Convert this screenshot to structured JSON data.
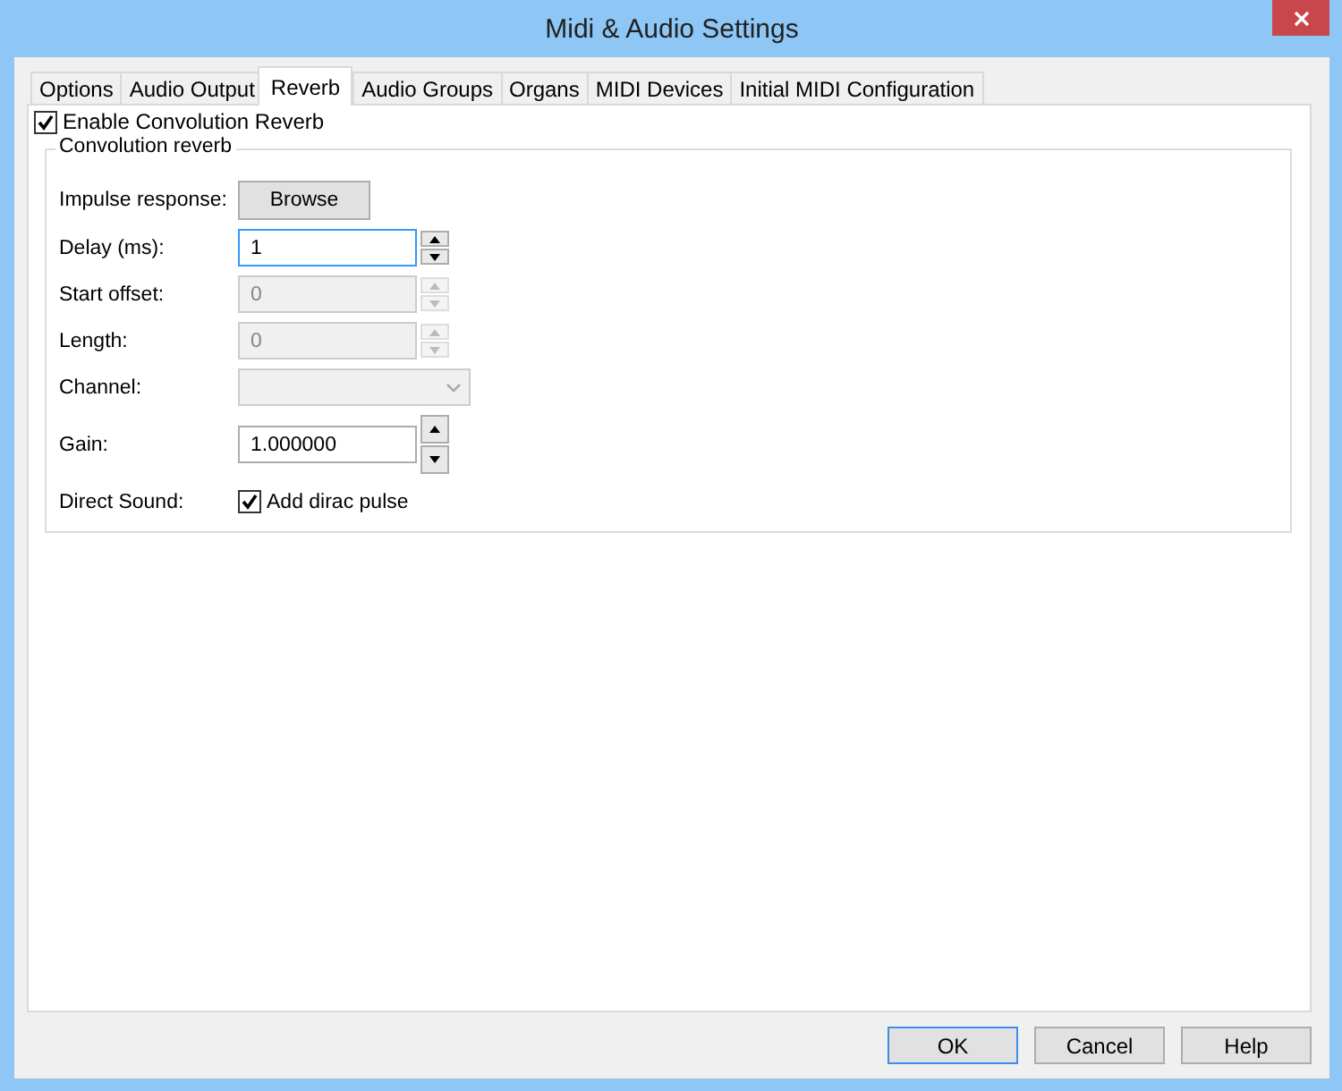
{
  "window": {
    "title": "Midi & Audio Settings"
  },
  "tabs": [
    {
      "label": "Options",
      "selected": false
    },
    {
      "label": "Audio Output",
      "selected": false
    },
    {
      "label": "Reverb",
      "selected": true
    },
    {
      "label": "Audio Groups",
      "selected": false
    },
    {
      "label": "Organs",
      "selected": false
    },
    {
      "label": "MIDI Devices",
      "selected": false
    },
    {
      "label": "Initial MIDI Configuration",
      "selected": false
    }
  ],
  "enable_reverb": {
    "label": "Enable Convolution Reverb",
    "checked": true
  },
  "group": {
    "title": "Convolution reverb",
    "rows": [
      {
        "kind": "button",
        "label": "Impulse response:",
        "button": "Browse"
      },
      {
        "kind": "spin",
        "label": "Delay (ms):",
        "value": "1",
        "disabled": false,
        "focused": true
      },
      {
        "kind": "spin",
        "label": "Start offset:",
        "value": "0",
        "disabled": true,
        "focused": false
      },
      {
        "kind": "spin",
        "label": "Length:",
        "value": "0",
        "disabled": true,
        "focused": false
      },
      {
        "kind": "combo",
        "label": "Channel:",
        "disabled": true
      },
      {
        "kind": "tallspin",
        "label": "Gain:",
        "value": "1.000000",
        "disabled": false,
        "focused": false
      },
      {
        "kind": "checkbox",
        "label": "Direct Sound:",
        "text": "Add dirac pulse",
        "checked": true
      }
    ]
  },
  "buttons": [
    {
      "label": "OK",
      "default": true
    },
    {
      "label": "Cancel",
      "default": false
    },
    {
      "label": "Help",
      "default": false
    }
  ]
}
